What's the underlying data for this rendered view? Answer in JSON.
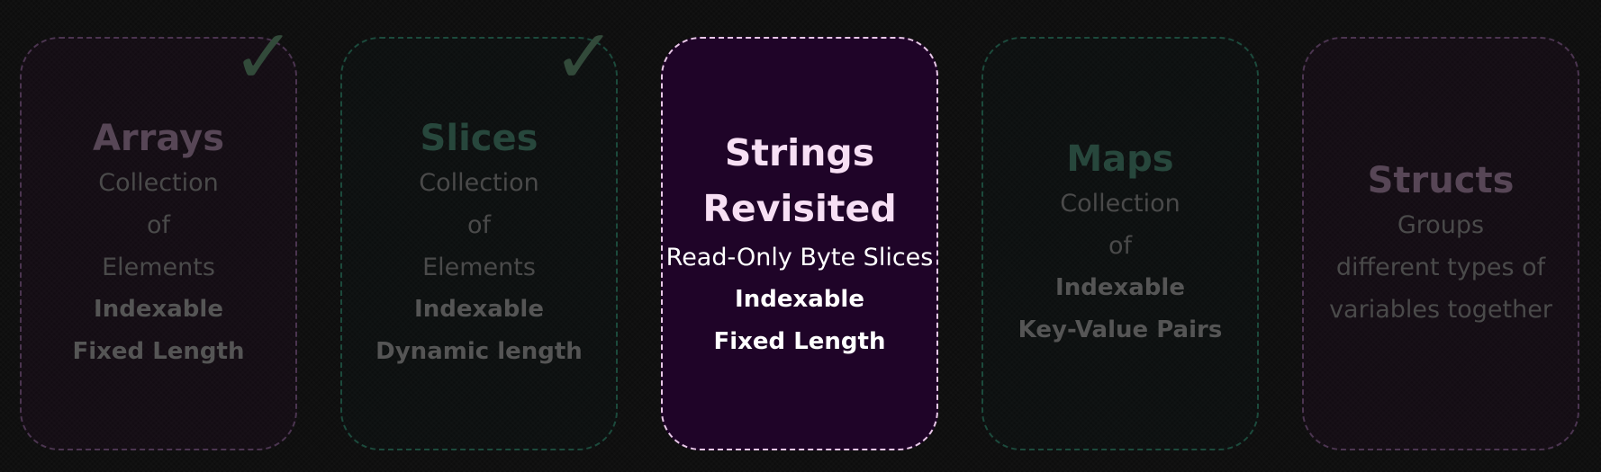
{
  "cards": [
    {
      "title": "Arrays",
      "lines": [
        "Collection",
        "of",
        "Elements"
      ],
      "bold_lines": [
        "Indexable",
        "Fixed Length"
      ],
      "completed": true
    },
    {
      "title": "Slices",
      "lines": [
        "Collection",
        "of",
        "Elements"
      ],
      "bold_lines": [
        "Indexable",
        "Dynamic length"
      ],
      "completed": true
    },
    {
      "title_line1": "Strings",
      "title_line2": "Revisited",
      "lines": [
        "Read-Only Byte Slices"
      ],
      "bold_lines": [
        "Indexable",
        "Fixed Length"
      ],
      "active": true
    },
    {
      "title": "Maps",
      "lines": [
        "Collection",
        "of"
      ],
      "bold_lines": [
        "Indexable",
        "Key-Value Pairs"
      ]
    },
    {
      "title": "Structs",
      "lines": [
        "Groups",
        "different types of",
        "variables together"
      ],
      "bold_lines": []
    }
  ],
  "icons": {
    "check": "✓",
    "check_color": "#324a3a"
  },
  "colors": {
    "active_bg": "#1f0428",
    "active_border": "#e8c6e8",
    "purple_border": "#4b3550",
    "green_border": "#1c4a3c"
  }
}
